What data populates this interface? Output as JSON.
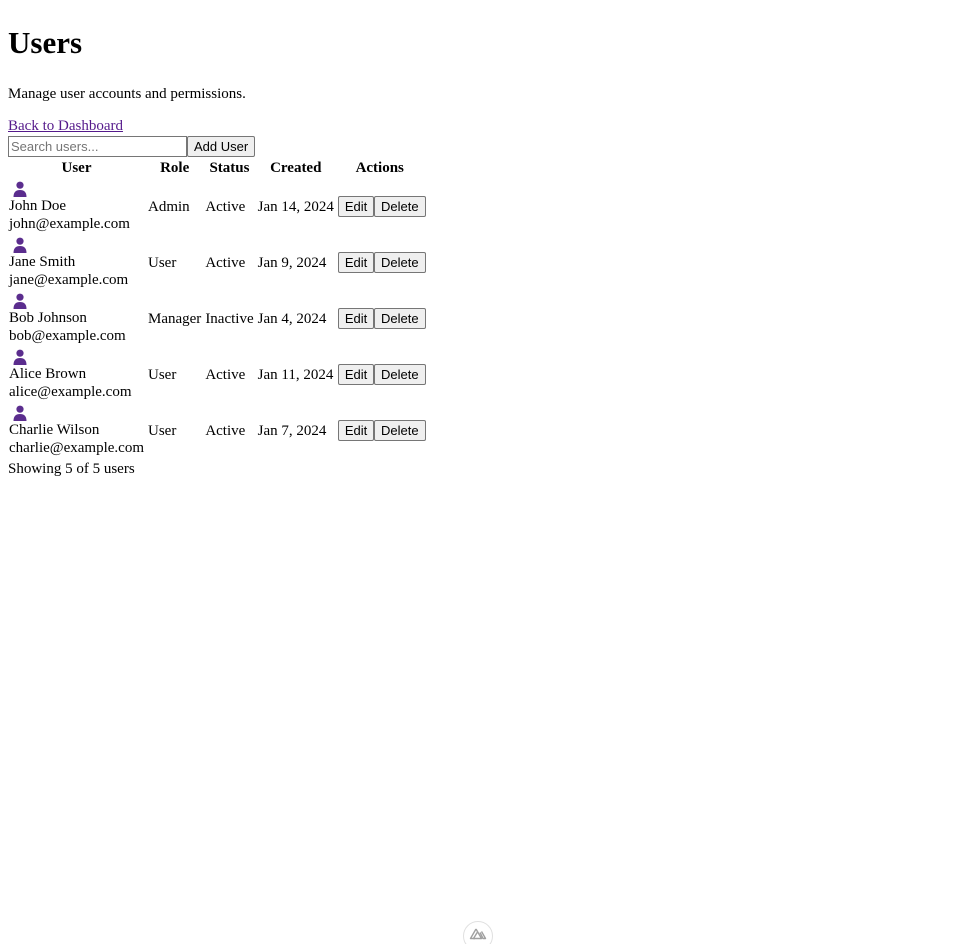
{
  "page": {
    "title": "Users",
    "subtitle": "Manage user accounts and permissions.",
    "back_link": "Back to Dashboard"
  },
  "toolbar": {
    "search_placeholder": "Search users...",
    "search_value": "",
    "add_user_label": "Add User"
  },
  "table": {
    "headers": [
      "User",
      "Role",
      "Status",
      "Created",
      "Actions"
    ],
    "rows": [
      {
        "name": "John Doe",
        "email": "john@example.com",
        "role": "Admin",
        "status": "Active",
        "created": "Jan 14, 2024",
        "edit": "Edit",
        "delete": "Delete",
        "avatar_icon": "user-icon"
      },
      {
        "name": "Jane Smith",
        "email": "jane@example.com",
        "role": "User",
        "status": "Active",
        "created": "Jan 9, 2024",
        "edit": "Edit",
        "delete": "Delete",
        "avatar_icon": "user-icon"
      },
      {
        "name": "Bob Johnson",
        "email": "bob@example.com",
        "role": "Manager",
        "status": "Inactive",
        "created": "Jan 4, 2024",
        "edit": "Edit",
        "delete": "Delete",
        "avatar_icon": "user-icon"
      },
      {
        "name": "Alice Brown",
        "email": "alice@example.com",
        "role": "User",
        "status": "Active",
        "created": "Jan 11, 2024",
        "edit": "Edit",
        "delete": "Delete",
        "avatar_icon": "user-icon"
      },
      {
        "name": "Charlie Wilson",
        "email": "charlie@example.com",
        "role": "User",
        "status": "Active",
        "created": "Jan 7, 2024",
        "edit": "Edit",
        "delete": "Delete",
        "avatar_icon": "user-icon"
      }
    ]
  },
  "footer": {
    "count_text": "Showing 5 of 5 users"
  },
  "colors": {
    "avatar": "#5b2d8e",
    "link_visited": "#551a8b",
    "button_bg": "#efefef",
    "button_border": "#767676"
  },
  "devtools_badge": {
    "icon": "nuxt-logo-icon"
  }
}
